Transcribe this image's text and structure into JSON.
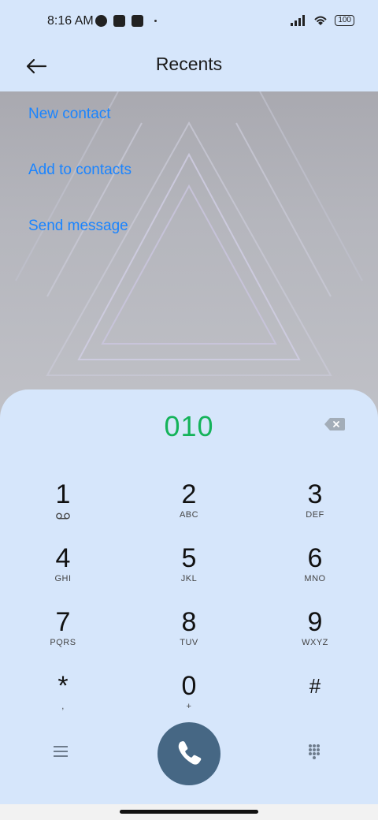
{
  "status_bar": {
    "time": "8:16 AM",
    "battery": "100"
  },
  "app_bar": {
    "title": "Recents"
  },
  "actions": [
    "New contact",
    "Add to contacts",
    "Send message"
  ],
  "dialer": {
    "number": "010",
    "keys": [
      {
        "digit": "1",
        "letters": ""
      },
      {
        "digit": "2",
        "letters": "ABC"
      },
      {
        "digit": "3",
        "letters": "DEF"
      },
      {
        "digit": "4",
        "letters": "GHI"
      },
      {
        "digit": "5",
        "letters": "JKL"
      },
      {
        "digit": "6",
        "letters": "MNO"
      },
      {
        "digit": "7",
        "letters": "PQRS"
      },
      {
        "digit": "8",
        "letters": "TUV"
      },
      {
        "digit": "9",
        "letters": "WXYZ"
      },
      {
        "digit": "*",
        "letters": ","
      },
      {
        "digit": "0",
        "letters": "+"
      },
      {
        "digit": "#",
        "letters": ""
      }
    ]
  },
  "colors": {
    "accent_link": "#1a84ff",
    "number": "#14b35a",
    "call_button": "#466784",
    "background": "#d6e6fb"
  },
  "icons": [
    "back-arrow-icon",
    "backspace-icon",
    "voicemail-icon",
    "menu-icon",
    "phone-icon",
    "dialpad-icon",
    "signal-icon",
    "wifi-icon",
    "battery-icon"
  ]
}
